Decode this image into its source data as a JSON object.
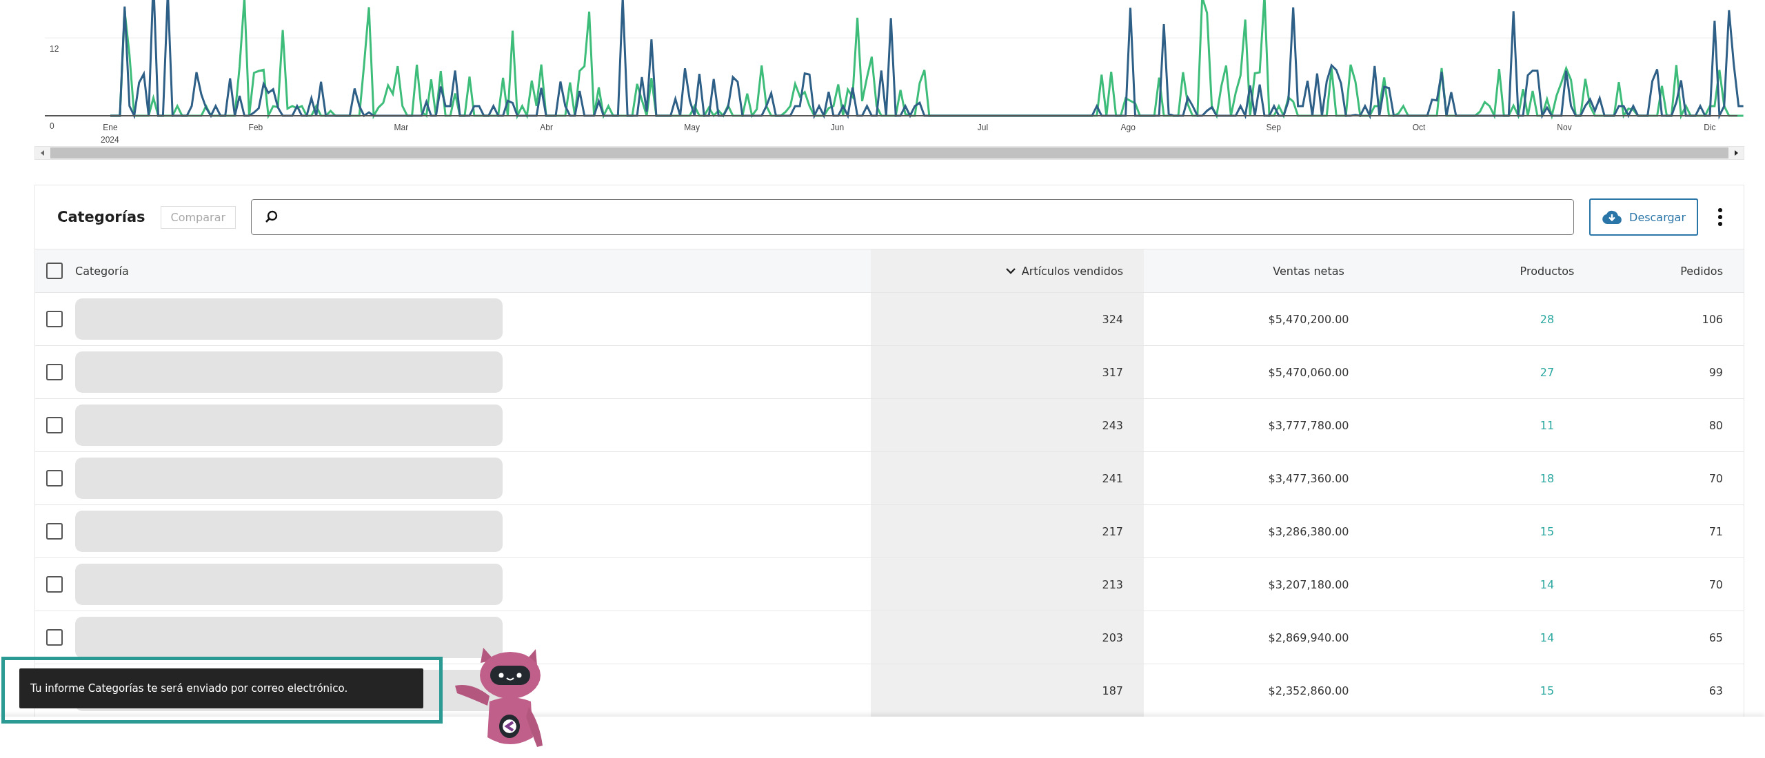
{
  "chart": {
    "y_labels": [
      "12",
      "0"
    ],
    "x_labels": [
      "Ene",
      "Feb",
      "Mar",
      "Abr",
      "May",
      "Jun",
      "Jul",
      "Ago",
      "Sep",
      "Oct",
      "Nov",
      "Dic"
    ],
    "year_label": "2024"
  },
  "table": {
    "title": "Categorías",
    "compare_button": "Comparar",
    "download_button": "Descargar",
    "columns": [
      {
        "label": "Categoría",
        "sorted": false
      },
      {
        "label": "Artículos vendidos",
        "sorted": true
      },
      {
        "label": "Ventas netas",
        "sorted": false
      },
      {
        "label": "Productos",
        "sorted": false
      },
      {
        "label": "Pedidos",
        "sorted": false
      }
    ],
    "header_checked": false,
    "rows": [
      {
        "checked": false,
        "items_sold": "324",
        "net_sales": "$5,470,200.00",
        "products": "28",
        "orders": "106"
      },
      {
        "checked": false,
        "items_sold": "317",
        "net_sales": "$5,470,060.00",
        "products": "27",
        "orders": "99"
      },
      {
        "checked": false,
        "items_sold": "243",
        "net_sales": "$3,777,780.00",
        "products": "11",
        "orders": "80"
      },
      {
        "checked": false,
        "items_sold": "241",
        "net_sales": "$3,477,360.00",
        "products": "18",
        "orders": "70"
      },
      {
        "checked": false,
        "items_sold": "217",
        "net_sales": "$3,286,380.00",
        "products": "15",
        "orders": "71"
      },
      {
        "checked": false,
        "items_sold": "213",
        "net_sales": "$3,207,180.00",
        "products": "14",
        "orders": "70"
      },
      {
        "checked": false,
        "items_sold": "203",
        "net_sales": "$2,869,940.00",
        "products": "14",
        "orders": "65"
      },
      {
        "items_sold": "187",
        "net_sales": "$2,352,860.00",
        "products": "15",
        "orders": "63"
      }
    ]
  },
  "toast": {
    "message": "Tu informe Categorías te será enviado por correo electrónico."
  }
}
